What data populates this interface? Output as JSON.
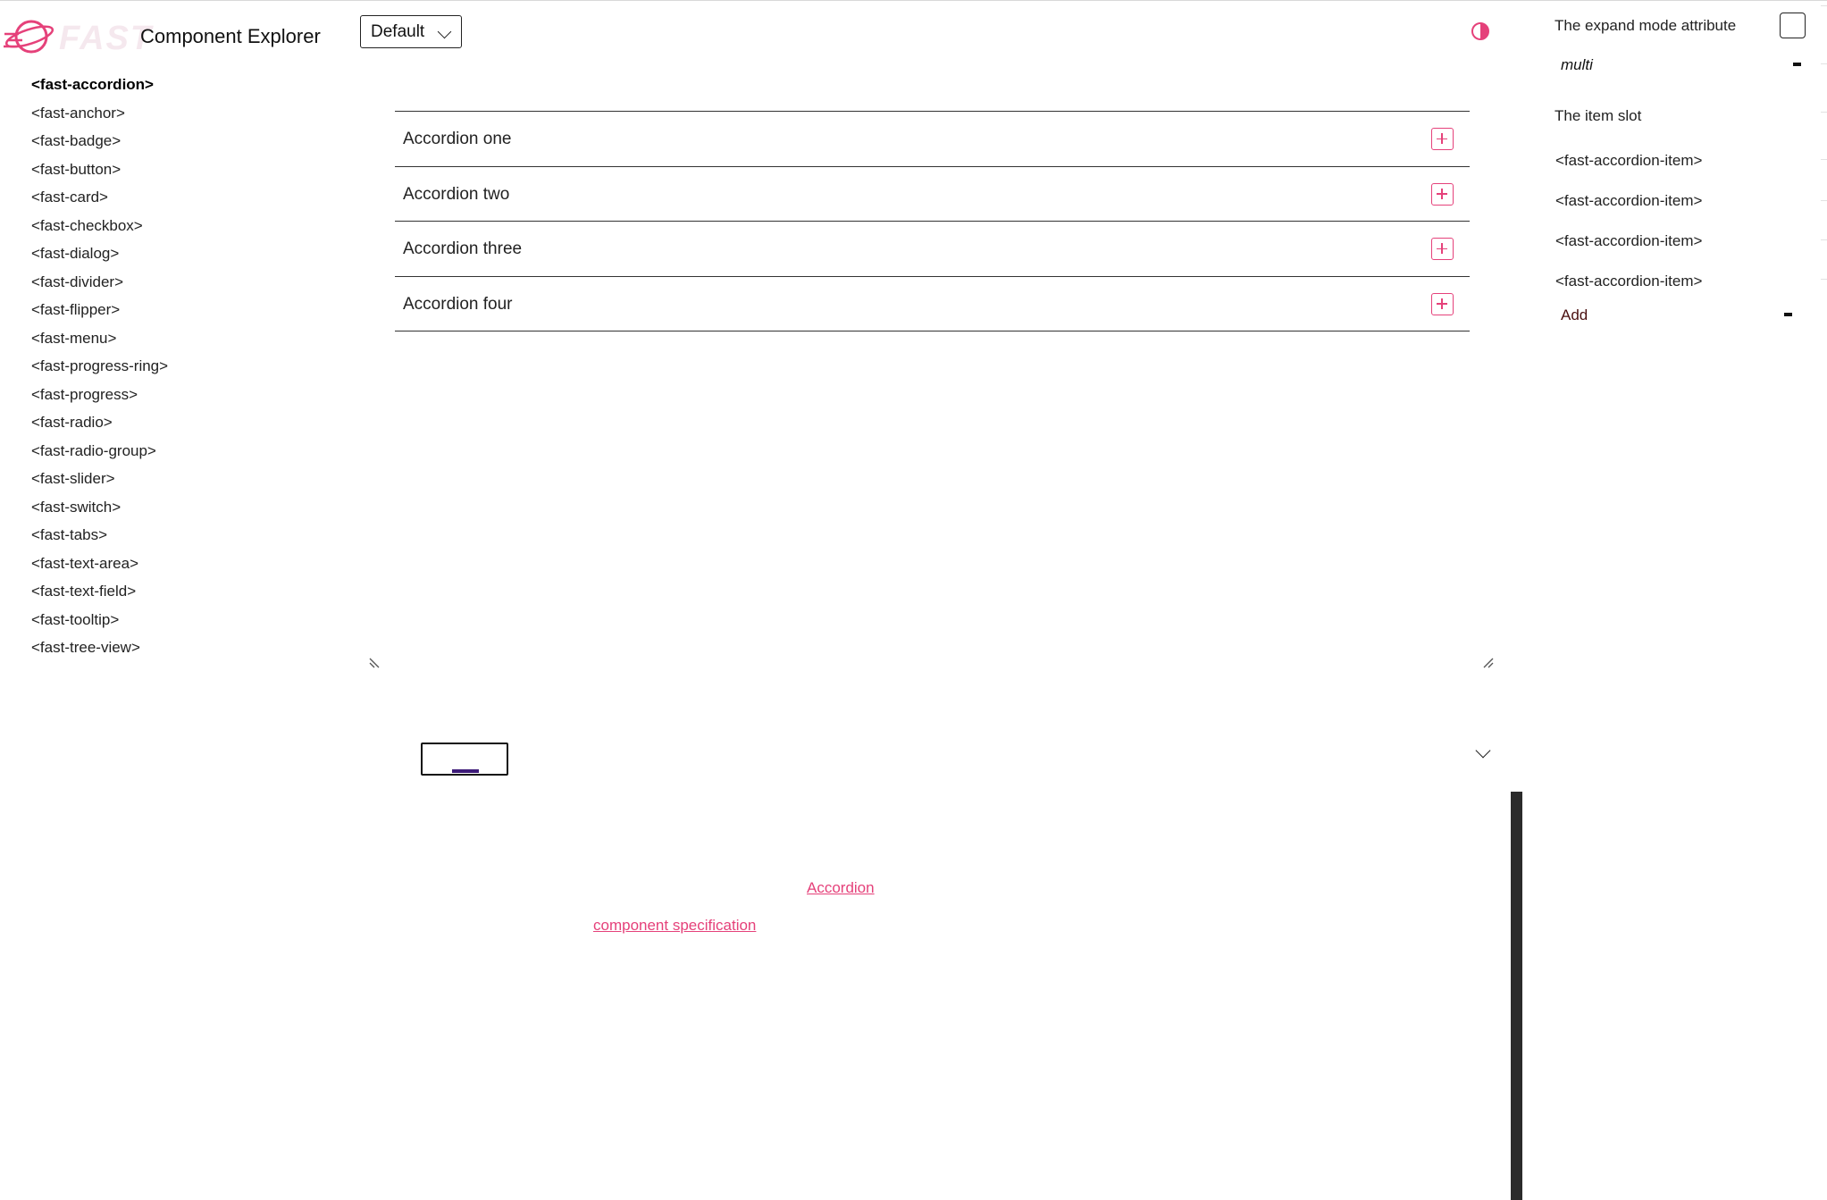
{
  "header": {
    "logo_text": "FAST",
    "title": "Component Explorer",
    "design_select": "Default"
  },
  "sidebar": {
    "items": [
      {
        "label": "<fast-accordion>",
        "active": true
      },
      {
        "label": "<fast-anchor>"
      },
      {
        "label": "<fast-badge>"
      },
      {
        "label": "<fast-button>"
      },
      {
        "label": "<fast-card>"
      },
      {
        "label": "<fast-checkbox>"
      },
      {
        "label": "<fast-dialog>"
      },
      {
        "label": "<fast-divider>"
      },
      {
        "label": "<fast-flipper>"
      },
      {
        "label": "<fast-menu>"
      },
      {
        "label": "<fast-progress-ring>"
      },
      {
        "label": "<fast-progress>"
      },
      {
        "label": "<fast-radio>"
      },
      {
        "label": "<fast-radio-group>"
      },
      {
        "label": "<fast-slider>"
      },
      {
        "label": "<fast-switch>"
      },
      {
        "label": "<fast-tabs>"
      },
      {
        "label": "<fast-text-area>"
      },
      {
        "label": "<fast-text-field>"
      },
      {
        "label": "<fast-tooltip>"
      },
      {
        "label": "<fast-tree-view>"
      }
    ]
  },
  "accordion": {
    "items": [
      {
        "heading": "Accordion one"
      },
      {
        "heading": "Accordion two"
      },
      {
        "heading": "Accordion three"
      },
      {
        "heading": "Accordion four"
      }
    ]
  },
  "links": {
    "accordion": "Accordion",
    "spec": "component specification"
  },
  "right_panel": {
    "expand_mode_label": "The expand mode attribute",
    "expand_mode_value": "multi",
    "item_slot_label": "The item slot",
    "slot_items": [
      "<fast-accordion-item>",
      "<fast-accordion-item>",
      "<fast-accordion-item>",
      "<fast-accordion-item>"
    ],
    "add_label": "Add"
  },
  "colors": {
    "accent": "#e5417a",
    "scrollbar": "#2b2b2b"
  },
  "icons": [
    "fast-logo-icon",
    "chevron-down-icon",
    "theme-toggle-icon",
    "resize-handle-icon",
    "add-icon"
  ]
}
